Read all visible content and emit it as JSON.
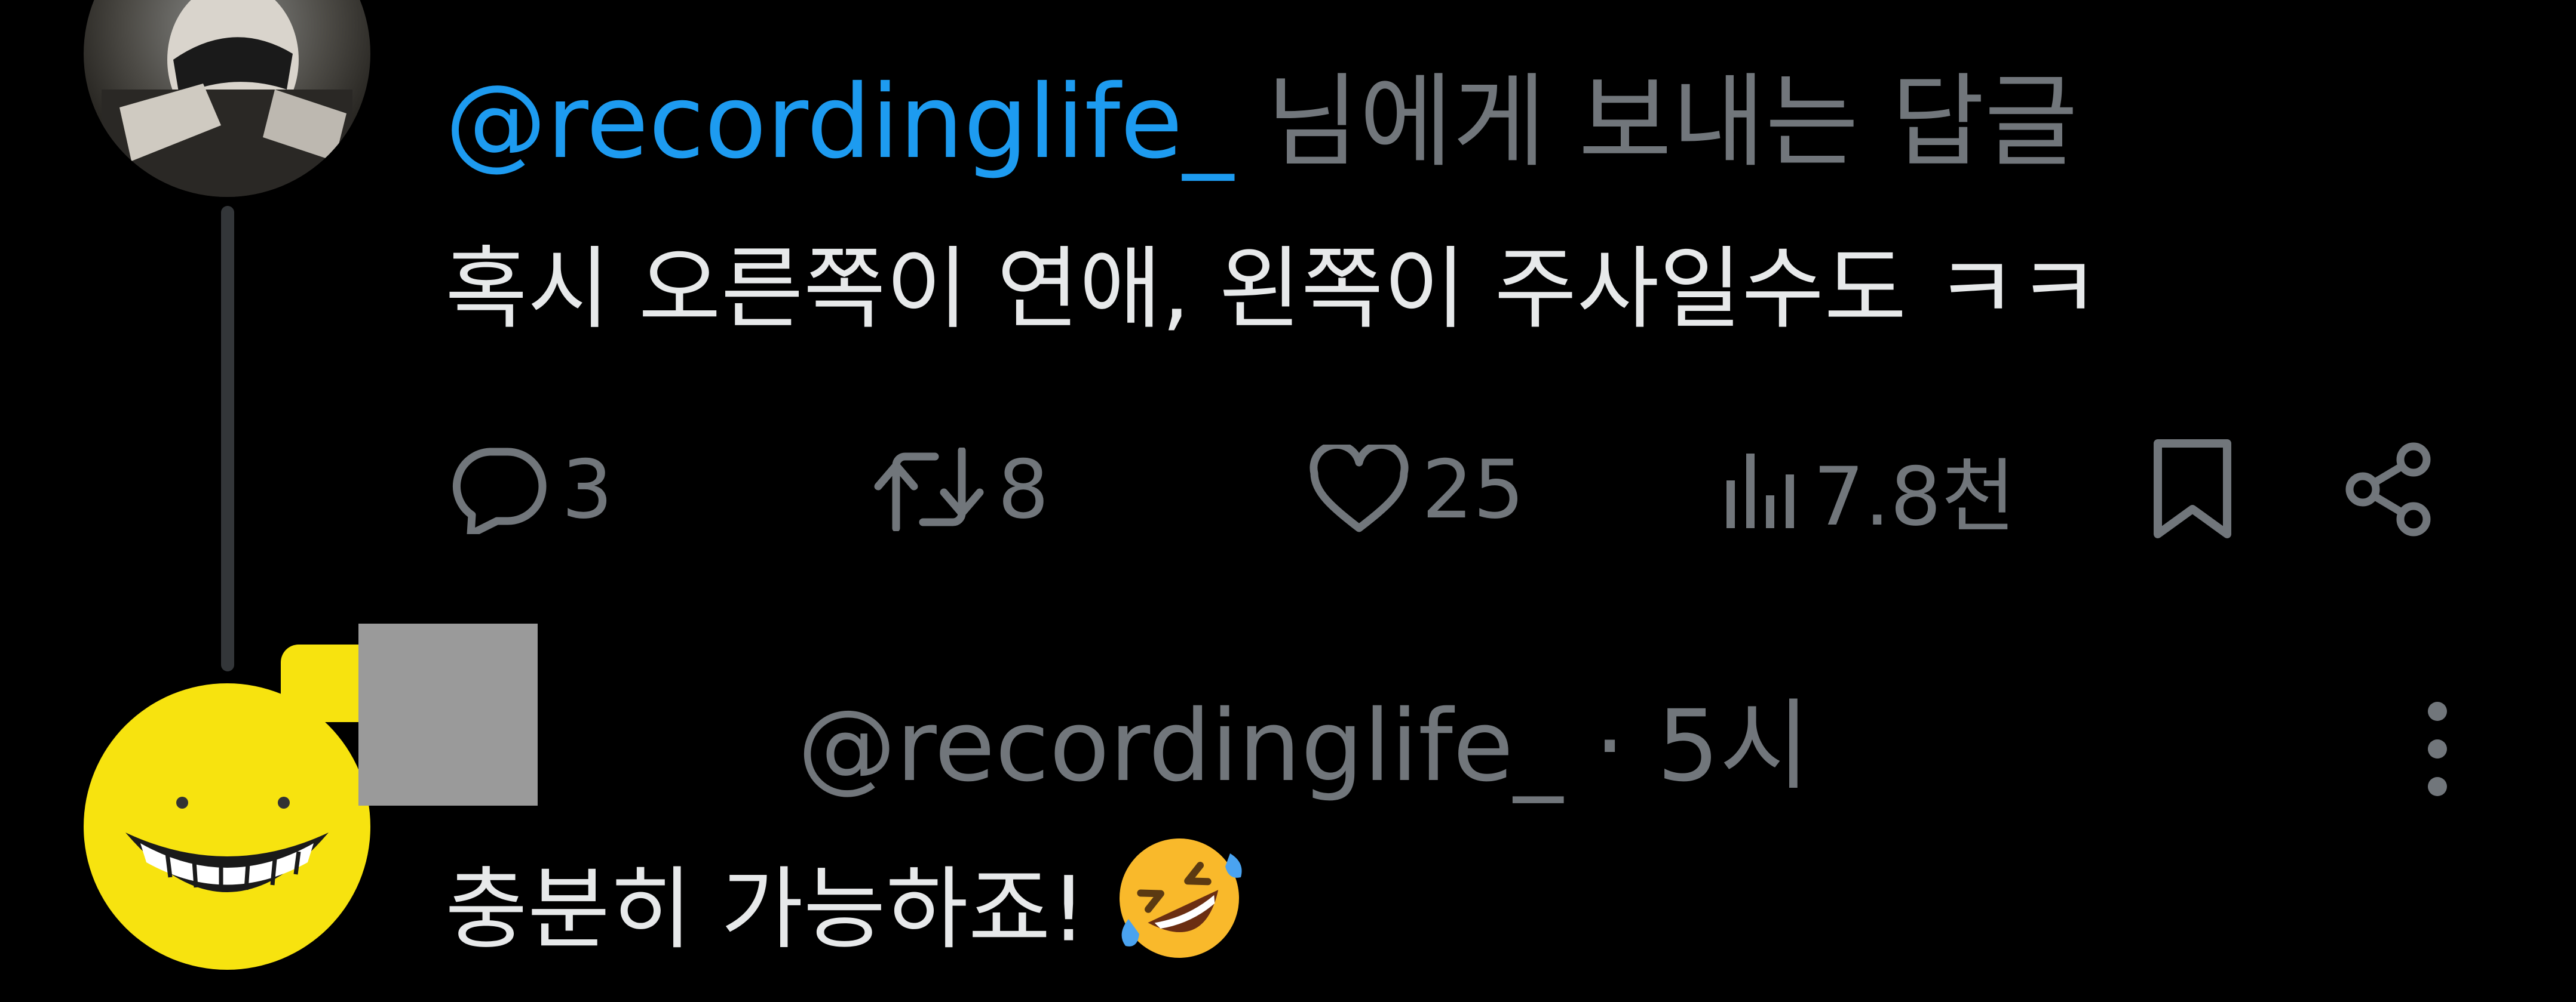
{
  "tweet1": {
    "reply_to_handle": "@recordinglife_",
    "reply_to_suffix": " 님에게 보내는 답글",
    "text": "혹시 오른쪽이 연애, 왼쪽이 주사일수도 ㅋㅋ",
    "actions": {
      "replies": "3",
      "retweets": "8",
      "likes": "25",
      "views": "7.8천"
    }
  },
  "tweet2": {
    "handle": "@recordinglife_",
    "separator": "·",
    "time": "5시",
    "text": "충분히 가능하죠!"
  },
  "colors": {
    "background": "#000000",
    "text": "#e7e9ea",
    "secondary": "#71767b",
    "link": "#1d9bf0",
    "avatar_yellow": "#f7e30f"
  },
  "icons": [
    "reply-icon",
    "retweet-icon",
    "like-icon",
    "views-icon",
    "bookmark-icon",
    "share-icon",
    "more-icon",
    "rofl-emoji"
  ]
}
